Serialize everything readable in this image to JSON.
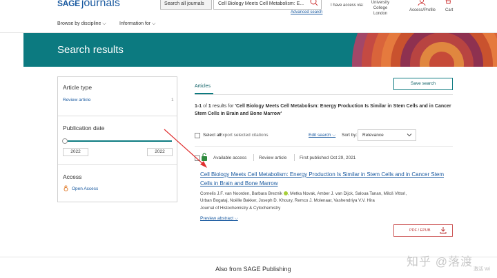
{
  "header": {
    "logo_sage": "SAGE",
    "logo_journals": "journals",
    "search_scope": "Search all journals",
    "search_value": "Cell Biology Meets Cell Metabolism: E...",
    "advanced_search": "Advanced search",
    "access_via": "I have access via:",
    "institution": "University College London",
    "profile_label": "Access/Profile",
    "cart_label": "Cart"
  },
  "nav": {
    "browse": "Browse by discipline",
    "info": "Information for"
  },
  "banner": {
    "title": "Search results",
    "color": "#0c7a80"
  },
  "sidebar": {
    "article_type": {
      "heading": "Article type",
      "items": [
        {
          "label": "Review article",
          "count": "1"
        }
      ]
    },
    "publication_date": {
      "heading": "Publication date",
      "from": "2022",
      "to": "2022"
    },
    "access": {
      "heading": "Access",
      "items": [
        {
          "label": "Open Access"
        }
      ]
    }
  },
  "main": {
    "tab_label": "Articles",
    "save_search": "Save search",
    "summary": {
      "range": "1-1",
      "of": " of ",
      "count": "1",
      "prefix": " results for ",
      "query": "'Cell Biology Meets Cell Metabolism: Energy Production Is Similar in Stem Cells and in Cancer Stem Cells in Brain and Bone Marrow'"
    },
    "select_all": "Select all",
    "export": "Export selected citations",
    "edit_search": "Edit search",
    "sort_label": "Sort by:",
    "sort_value": "Relevance",
    "result": {
      "access": "Available access",
      "type": "Review article",
      "published": "First published Oct 29, 2021",
      "title": "Cell Biology Meets Cell Metabolism: Energy Production Is Similar in Stem Cells and in Cancer Stem Cells in Brain and Bone Marrow",
      "authors_1": "Cornelis J.F. van Noorden, Barbara Breznik",
      "authors_2": ", Metka Novak, Amber J. van Dijck, Saloua Tanan, Miloš Vittori,",
      "authors_3": "Urban Bogataj, Noëlle Bakker, Joseph D. Khoury, Remco J. Molenaar, Vashendriya V.V. Hira",
      "journal": "Journal of Histochemistry & Cytochemistry",
      "preview": "Preview abstract",
      "pdf": "PDF / EPUB"
    }
  },
  "footer": {
    "text": "Also from SAGE Publishing"
  },
  "watermark": {
    "text": "知乎 @落渡",
    "small": "激活 Wi"
  }
}
